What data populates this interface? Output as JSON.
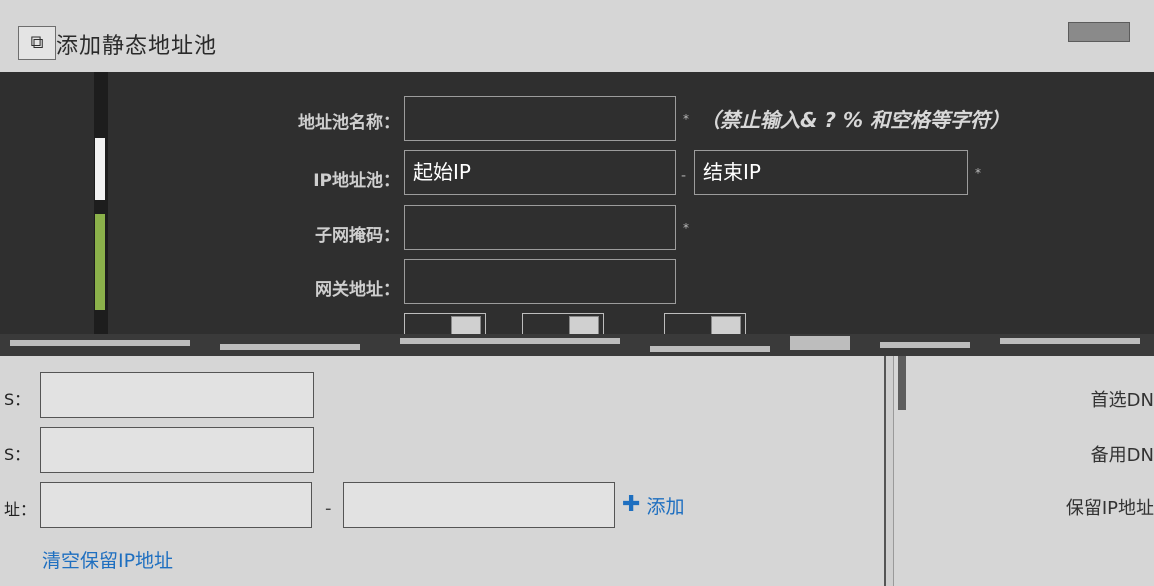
{
  "dialog": {
    "title": "添加静态地址池",
    "title_icon": "network-icon"
  },
  "form": {
    "pool_name_label": "地址池名称：",
    "pool_name_value": "",
    "pool_name_hint": "（禁止输入& ? % 和空格等字符）",
    "ip_range_label": "IP地址池：",
    "start_ip_placeholder": "起始IP",
    "end_ip_placeholder": "结束IP",
    "range_dash": "-",
    "subnet_label": "子网掩码：",
    "gateway_label": "网关地址：",
    "required_mark": "*"
  },
  "lower_left": {
    "dns1_label_fragment": "S：",
    "dns2_label_fragment": "S：",
    "reserve_label_fragment": "址：",
    "reserve_range_dash": "-",
    "add_label": "添加",
    "clear_reserved_label": "清空保留IP地址"
  },
  "lower_right": {
    "primary_dns_label": "首选DN",
    "backup_dns_label": "备用DN",
    "reserved_ip_label": "保留IP地址"
  },
  "colors": {
    "link_blue": "#1e6fc0",
    "dark_bg": "#2f2f2f",
    "light_bg": "#d6d6d6",
    "scroll_green": "#8bb14a"
  }
}
